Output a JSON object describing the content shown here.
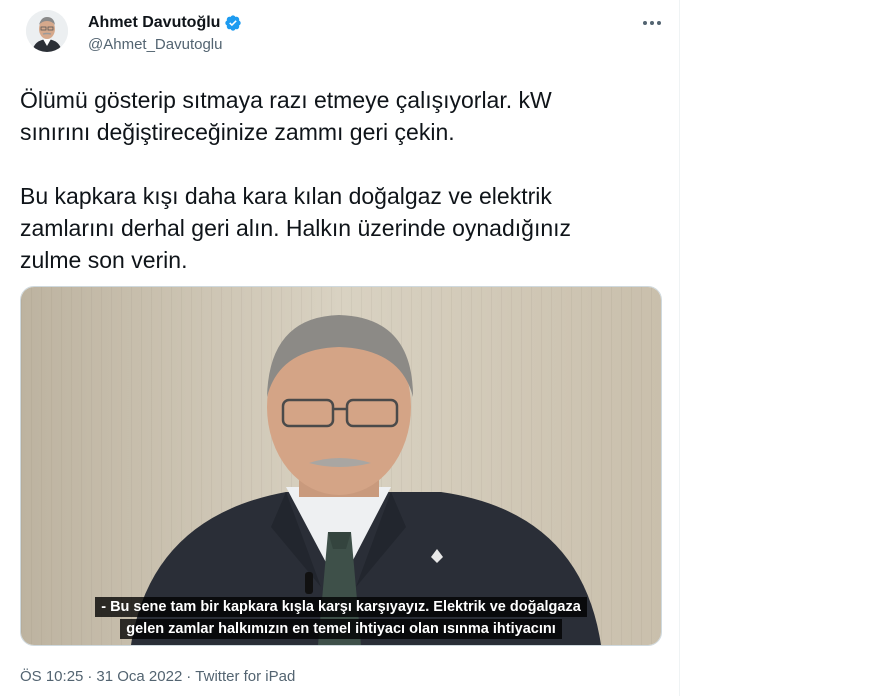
{
  "author": {
    "name": "Ahmet Davutoğlu",
    "handle": "@Ahmet_Davutoglu",
    "verified": true
  },
  "tweet": {
    "text": "Ölümü gösterip sıtmaya razı etmeye çalışıyorlar. kW\nsınırını değiştireceğinize zammı geri çekin.\n\nBu kapkara kışı daha kara kılan doğalgaz ve elektrik\nzamlarını derhal geri alın. Halkın üzerinde oynadığınız\nzulme son verin."
  },
  "video": {
    "caption_line1": "- Bu sene tam bir kapkara kışla karşı karşıyayız. Elektrik ve doğalgaza",
    "caption_line2": "gelen zamlar halkımızın en temel ihtiyacı olan ısınma ihtiyacını"
  },
  "meta": {
    "time": "ÖS 10:25",
    "sep1": "·",
    "date": "31 Oca 2022",
    "sep2": "·",
    "source": "Twitter for iPad"
  },
  "colors": {
    "verified": "#1d9bf0",
    "secondary_text": "#536471",
    "primary_text": "#0f1419"
  },
  "icons": [
    "verified-badge-icon",
    "more-options-icon"
  ]
}
